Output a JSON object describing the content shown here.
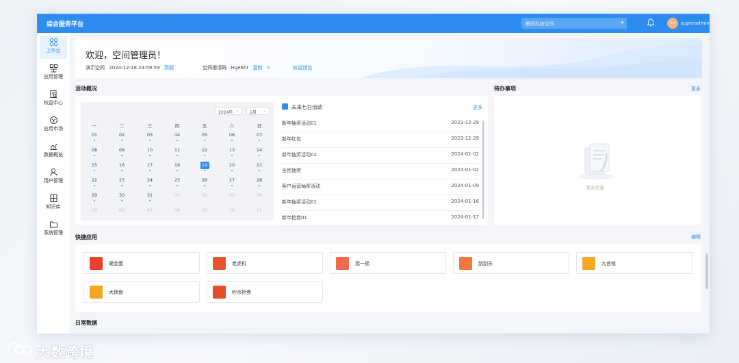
{
  "app": {
    "title": "综合服务平台"
  },
  "header": {
    "space_select": "晨阳科技空间",
    "user_initials": "su",
    "username": "superadmin"
  },
  "sidebar": {
    "items": [
      {
        "label": "工作台",
        "icon": "grid-icon"
      },
      {
        "label": "应用管理",
        "icon": "app-icon"
      },
      {
        "label": "权益中心",
        "icon": "document-search-icon"
      },
      {
        "label": "应用市场",
        "icon": "cube-icon"
      },
      {
        "label": "数据概览",
        "icon": "chart-icon"
      },
      {
        "label": "用户管理",
        "icon": "user-icon"
      },
      {
        "label": "知识库",
        "icon": "book-icon"
      },
      {
        "label": "系统管理",
        "icon": "folder-icon"
      }
    ]
  },
  "welcome": {
    "greeting": "欢迎，空间管理员！",
    "space_name": "演示空间",
    "datetime": "2024-12-18 23:59:59",
    "renew": "到期",
    "invite_label": "空间邀请码",
    "invite_code": "Hge6hr",
    "copy": "复制",
    "benefits": "权益钱包"
  },
  "activity": {
    "title": "活动概况",
    "year_select": "2024年",
    "month_select": "1月",
    "weekdays": [
      "一",
      "二",
      "三",
      "四",
      "五",
      "六",
      "日"
    ],
    "weeks": [
      [
        "01",
        "02",
        "03",
        "04",
        "05",
        "06",
        "07"
      ],
      [
        "08",
        "09",
        "10",
        "11",
        "12",
        "13",
        "14"
      ],
      [
        "15",
        "16",
        "17",
        "18",
        "19",
        "20",
        "21"
      ],
      [
        "22",
        "23",
        "24",
        "25",
        "26",
        "27",
        "28"
      ],
      [
        "29",
        "30",
        "31",
        "01",
        "02",
        "03",
        "04"
      ],
      [
        "05",
        "06",
        "07",
        "08",
        "09",
        "10",
        "11"
      ]
    ],
    "today_index": [
      2,
      4
    ],
    "upcoming_title": "未来七日活动",
    "upcoming_more": "更多",
    "upcoming": [
      {
        "name": "新年抽奖活动01",
        "date": "2023-12-29"
      },
      {
        "name": "新年红包",
        "date": "2023-12-29"
      },
      {
        "name": "新年抽奖活动02",
        "date": "2024-01-02"
      },
      {
        "name": "全民抽奖",
        "date": "2024-01-02"
      },
      {
        "name": "客户运营抽奖活动",
        "date": "2024-01-09"
      },
      {
        "name": "新年抽奖活动01",
        "date": "2024-01-16"
      },
      {
        "name": "新年抢券01",
        "date": "2024-01-17"
      }
    ]
  },
  "todo": {
    "title": "待办事项",
    "more": "更多",
    "empty": "暂无信息"
  },
  "quick": {
    "title": "快捷应用",
    "edit": "编辑",
    "apps": [
      {
        "label": "砸金蛋",
        "color": "#e8412c"
      },
      {
        "label": "老虎机",
        "color": "#e8552c"
      },
      {
        "label": "摇一摇",
        "color": "#ee6a4a"
      },
      {
        "label": "刮刮乐",
        "color": "#f07a3a"
      },
      {
        "label": "九宫格",
        "color": "#f5a623"
      },
      {
        "label": "大转盘",
        "color": "#f5a623"
      },
      {
        "label": "秒杀抢券",
        "color": "#e84a2c"
      }
    ]
  },
  "daily": {
    "title": "日常数据"
  },
  "watermark": {
    "text": "大数跨境"
  }
}
